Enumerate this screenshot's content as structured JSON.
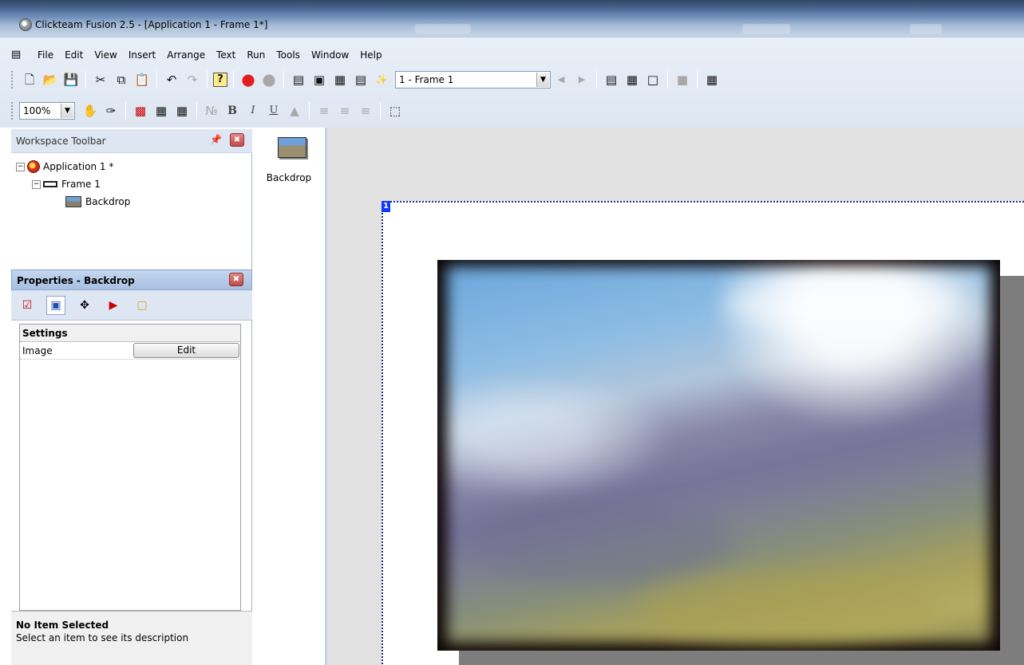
{
  "window": {
    "title": "Clickteam Fusion 2.5 - [Application 1 - Frame 1*]"
  },
  "menu": {
    "items": [
      "File",
      "Edit",
      "View",
      "Insert",
      "Arrange",
      "Text",
      "Run",
      "Tools",
      "Window",
      "Help"
    ]
  },
  "toolbar": {
    "frame_select_value": "1 - Frame 1",
    "zoom_value": "100%"
  },
  "workspace": {
    "title": "Workspace Toolbar",
    "tree": {
      "application": "Application 1 *",
      "frame": "Frame 1",
      "object": "Backdrop"
    }
  },
  "properties": {
    "title": "Properties - Backdrop",
    "section": "Settings",
    "rows": [
      {
        "label": "Image",
        "button": "Edit"
      }
    ],
    "description_title": "No Item Selected",
    "description_text": "Select an item to see its description"
  },
  "shelf": {
    "object_label": "Backdrop"
  },
  "editor": {
    "frame_number": "1"
  },
  "icons": {
    "title": "app-logo-icon",
    "menu": "menu-list-icon",
    "close": "close-icon",
    "pin": "pin-icon"
  },
  "colors": {
    "frame_number_bg": "#1038ff",
    "selection_border": "#1c2a88"
  }
}
